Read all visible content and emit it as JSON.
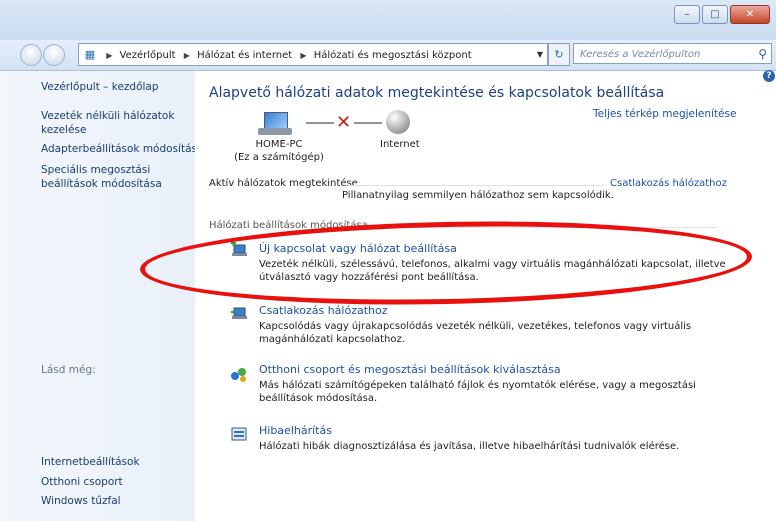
{
  "window": {
    "min_label": "–",
    "max_label": "□",
    "close_label": "✕"
  },
  "navbar": {
    "breadcrumbs": [
      "Vezérlőpult",
      "Hálózat és internet",
      "Hálózati és megosztási központ"
    ],
    "search_placeholder": "Keresés a Vezérlőpulton"
  },
  "sidebar": {
    "items": [
      "Vezérlőpult – kezdőlap",
      "Vezeték nélküli hálózatok kezelése",
      "Adapterbeállítások módosítása",
      "Speciális megosztási beállítások módosítása"
    ],
    "see_also_label": "Lásd még:",
    "see_also": [
      "Internetbeállítások",
      "Otthoni csoport",
      "Windows tűzfal"
    ]
  },
  "main": {
    "title": "Alapvető hálózati adatok megtekintése és kapcsolatok beállítása",
    "full_map_link": "Teljes térkép megjelenítése",
    "computer_name": "HOME-PC",
    "computer_sub": "(Ez a számítógép)",
    "internet_label": "Internet",
    "active_networks_heading": "Aktív hálózatok megtekintése",
    "connect_link": "Csatlakozás hálózathoz",
    "no_network_text": "Pillanatnyilag semmilyen hálózathoz sem kapcsolódik.",
    "change_settings_heading": "Hálózati beállítások módosítása",
    "tasks": [
      {
        "title": "Új kapcsolat vagy hálózat beállítása",
        "desc": "Vezeték nélküli, szélessávú, telefonos, alkalmi vagy virtuális magánhálózati kapcsolat, illetve útválasztó vagy hozzáférési pont beállítása."
      },
      {
        "title": "Csatlakozás hálózathoz",
        "desc": "Kapcsolódás vagy újrakapcsolódás vezeték nélküli, vezetékes, telefonos vagy virtuális magánhálózati kapcsolathoz."
      },
      {
        "title": "Otthoni csoport és megosztási beállítások kiválasztása",
        "desc": "Más hálózati számítógépeken található fájlok és nyomtatók elérése, vagy a megosztási beállítások módosítása."
      },
      {
        "title": "Hibaelhárítás",
        "desc": "Hálózati hibák diagnosztizálása és javítása, illetve hibaelhárítási tudnivalók elérése."
      }
    ]
  }
}
